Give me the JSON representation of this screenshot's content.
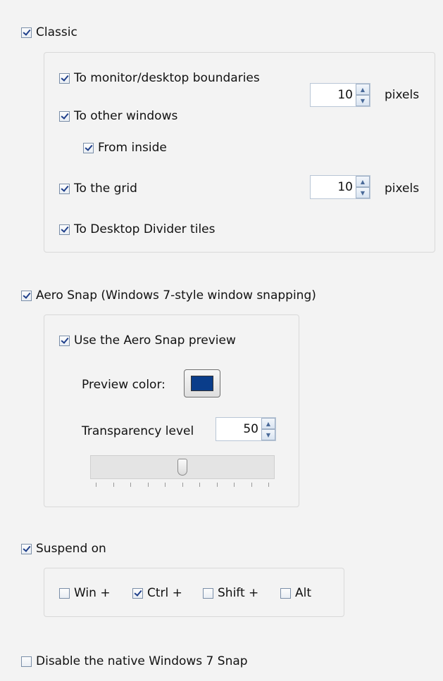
{
  "classic": {
    "label": "Classic",
    "checked": true,
    "monitor_boundaries": "To monitor/desktop boundaries",
    "other_windows": "To other windows",
    "from_inside": "From inside",
    "grid": "To the grid",
    "divider_tiles": "To Desktop Divider tiles",
    "snap_distance": "10",
    "grid_distance": "10",
    "unit": "pixels"
  },
  "aero": {
    "label": "Aero Snap (Windows 7-style window snapping)",
    "preview_label": "Use the Aero Snap preview",
    "preview_color_label": "Preview color:",
    "preview_color": "#0a3d8a",
    "transparency_label": "Transparency level",
    "transparency_value": "50",
    "slider_fraction": 0.5
  },
  "suspend": {
    "label": "Suspend on",
    "win": "Win +",
    "ctrl": "Ctrl +",
    "shift": "Shift +",
    "alt": "Alt"
  },
  "disable_native": "Disable the native Windows 7 Snap",
  "colors": {
    "check": "#1f3f8a",
    "accent_border": "#b9c6d6"
  }
}
